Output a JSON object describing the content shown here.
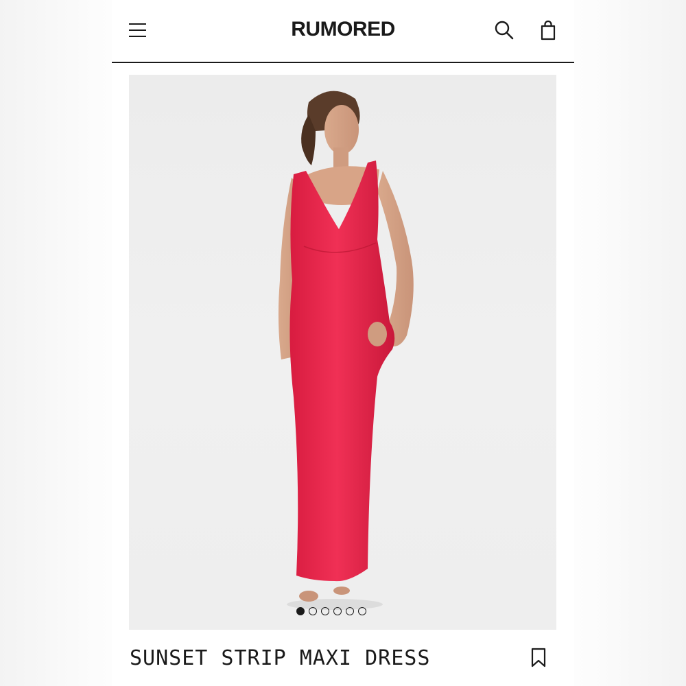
{
  "header": {
    "brand": "RUMORED",
    "icons": [
      "menu-icon",
      "search-icon",
      "shopping-bag-icon"
    ]
  },
  "gallery": {
    "image_description_icon": "product-photo",
    "dress_color": "#e8234a",
    "slide_count": 6,
    "active_slide": 1
  },
  "product": {
    "title": "SUNSET STRIP MAXI DRESS",
    "bookmark_icon": "bookmark-icon"
  },
  "colors": {
    "text": "#1a1a1a",
    "background": "#ffffff",
    "accent": "#e8234a"
  }
}
